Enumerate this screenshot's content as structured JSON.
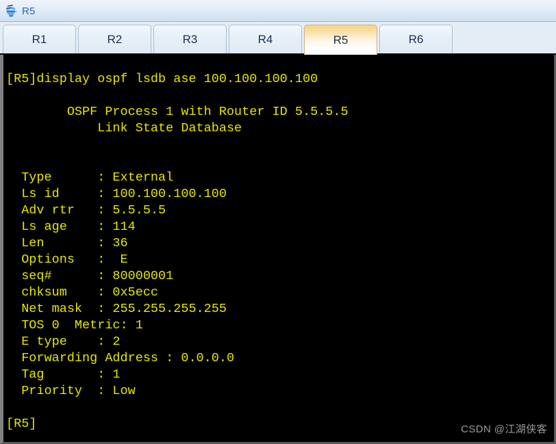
{
  "window": {
    "title": "R5",
    "icon": "router-device-icon"
  },
  "tabs": {
    "items": [
      {
        "label": "R1",
        "active": false
      },
      {
        "label": "R2",
        "active": false
      },
      {
        "label": "R3",
        "active": false
      },
      {
        "label": "R4",
        "active": false
      },
      {
        "label": "R5",
        "active": true
      },
      {
        "label": "R6",
        "active": false
      }
    ],
    "active_index": 4
  },
  "terminal": {
    "foreground_color": "#e5e500",
    "background_color": "#000000",
    "prompt": "[R5]",
    "command": "display ospf lsdb ase 100.100.100.100",
    "lines": [
      "",
      "[R5]display ospf lsdb ase 100.100.100.100",
      "",
      "        OSPF Process 1 with Router ID 5.5.5.5",
      "            Link State Database",
      "",
      "",
      "  Type      : External",
      "  Ls id     : 100.100.100.100",
      "  Adv rtr   : 5.5.5.5",
      "  Ls age    : 114",
      "  Len       : 36",
      "  Options   :  E",
      "  seq#      : 80000001",
      "  chksum    : 0x5ecc",
      "  Net mask  : 255.255.255.255",
      "  TOS 0  Metric: 1",
      "  E type    : 2",
      "  Forwarding Address : 0.0.0.0",
      "  Tag       : 1",
      "  Priority  : Low",
      "",
      "[R5]"
    ],
    "lsa": {
      "header_process": "OSPF Process 1 with Router ID 5.5.5.5",
      "header_database": "Link State Database",
      "fields": [
        {
          "label": "Type",
          "value": "External"
        },
        {
          "label": "Ls id",
          "value": "100.100.100.100"
        },
        {
          "label": "Adv rtr",
          "value": "5.5.5.5"
        },
        {
          "label": "Ls age",
          "value": "114"
        },
        {
          "label": "Len",
          "value": "36"
        },
        {
          "label": "Options",
          "value": "E"
        },
        {
          "label": "seq#",
          "value": "80000001"
        },
        {
          "label": "chksum",
          "value": "0x5ecc"
        },
        {
          "label": "Net mask",
          "value": "255.255.255.255"
        },
        {
          "label": "TOS 0  Metric",
          "value": "1"
        },
        {
          "label": "E type",
          "value": "2"
        },
        {
          "label": "Forwarding Address",
          "value": "0.0.0.0"
        },
        {
          "label": "Tag",
          "value": "1"
        },
        {
          "label": "Priority",
          "value": "Low"
        }
      ]
    }
  },
  "watermark": {
    "text": "CSDN @江湖侠客"
  }
}
